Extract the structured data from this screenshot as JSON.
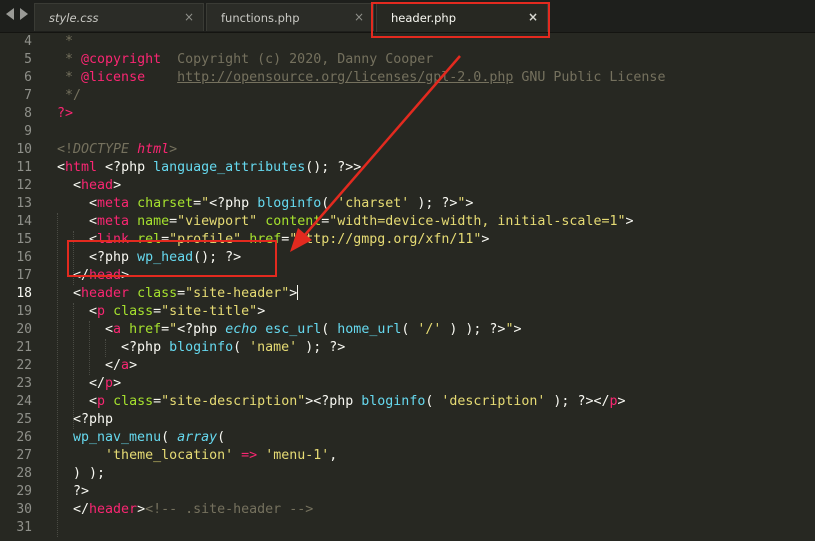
{
  "tabs": [
    {
      "label": "style.css",
      "close": "×",
      "active": false
    },
    {
      "label": "functions.php",
      "close": "×",
      "active": false
    },
    {
      "label": "header.php",
      "close": "×",
      "active": true
    }
  ],
  "line_numbers": [
    "4",
    "5",
    "6",
    "7",
    "8",
    "9",
    "10",
    "11",
    "12",
    "13",
    "14",
    "15",
    "16",
    "17",
    "18",
    "19",
    "20",
    "21",
    "22",
    "23",
    "24",
    "25",
    "26",
    "27",
    "28",
    "29",
    "30",
    "31"
  ],
  "current_line": "18",
  "code": {
    "l4": [
      " *"
    ],
    "l5": [
      " * ",
      "@copyright",
      "  Copyright (c) 2020, Danny Cooper"
    ],
    "l6": [
      " * ",
      "@license",
      "    ",
      "http://opensource.org/licenses/gpl-2.0.php",
      " GNU Public License"
    ],
    "l7": [
      " */"
    ],
    "l8": [
      "?>"
    ],
    "l10": [
      "<!",
      "DOCTYPE",
      " ",
      "html",
      ">"
    ],
    "l11": [
      "<",
      "html",
      " <?php ",
      "language_attributes",
      "(); ?>",
      ">"
    ],
    "l12": [
      "  <",
      "head",
      ">"
    ],
    "l13": [
      "    <",
      "meta",
      " ",
      "charset",
      "=",
      "\"",
      "<?php ",
      "bloginfo",
      "( ",
      "'charset'",
      " ); ?>",
      "\"",
      ">"
    ],
    "l14": [
      "    <",
      "meta",
      " ",
      "name",
      "=",
      "\"viewport\"",
      " ",
      "content",
      "=",
      "\"width=device-width, initial-scale=1\"",
      ">"
    ],
    "l15": [
      "    <",
      "link",
      " ",
      "rel",
      "=",
      "\"profile\"",
      " ",
      "href",
      "=",
      "\"http://gmpg.org/xfn/11\"",
      ">"
    ],
    "l16": [
      "    <?php ",
      "wp_head",
      "(); ?>"
    ],
    "l17": [
      "  </",
      "head",
      ">"
    ],
    "l18": [
      "  <",
      "header",
      " ",
      "class",
      "=",
      "\"site-header\"",
      ">"
    ],
    "l19": [
      "    <",
      "p",
      " ",
      "class",
      "=",
      "\"site-title\"",
      ">"
    ],
    "l20": [
      "      <",
      "a",
      " ",
      "href",
      "=",
      "\"",
      "<?php ",
      "echo",
      " ",
      "esc_url",
      "( ",
      "home_url",
      "( ",
      "'/'",
      " ) ); ?>",
      "\"",
      ">"
    ],
    "l21": [
      "        <?php ",
      "bloginfo",
      "( ",
      "'name'",
      " ); ?>"
    ],
    "l22": [
      "      </",
      "a",
      ">"
    ],
    "l23": [
      "    </",
      "p",
      ">"
    ],
    "l24": [
      "    <",
      "p",
      " ",
      "class",
      "=",
      "\"site-description\"",
      ">",
      "<?php ",
      "bloginfo",
      "( ",
      "'description'",
      " ); ?>",
      "</",
      "p",
      ">"
    ],
    "l25": [
      "  <?php"
    ],
    "l26": [
      "  ",
      "wp_nav_menu",
      "( ",
      "array",
      "("
    ],
    "l27": [
      "      ",
      "'theme_location'",
      " ",
      "=>",
      " ",
      "'menu-1'",
      ","
    ],
    "l28": [
      "  ) );"
    ],
    "l29": [
      "  ?>"
    ],
    "l30": [
      "  </",
      "header",
      ">",
      "<!-- .site-header -->"
    ],
    "l31": [
      ""
    ]
  },
  "colors": {
    "editor_bg": "#272822",
    "annotation": "#e32a1f",
    "tag": "#f92672",
    "string": "#e6db74",
    "attribute": "#a6e22e",
    "function": "#66d9ef",
    "comment": "#75715e"
  },
  "icons": [
    "nav-left-icon",
    "nav-right-icon",
    "tab-close-icon",
    "annotation-arrow"
  ]
}
